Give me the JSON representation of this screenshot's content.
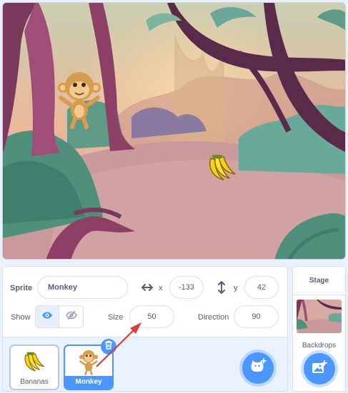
{
  "sprite_info": {
    "sprite_label": "Sprite",
    "sprite_name": "Monkey",
    "x_label": "x",
    "x_value": "-133",
    "y_label": "y",
    "y_value": "42",
    "show_label": "Show",
    "size_label": "Size",
    "size_value": "50",
    "direction_label": "Direction",
    "direction_value": "90"
  },
  "sprites": [
    {
      "name": "Bananas",
      "selected": false
    },
    {
      "name": "Monkey",
      "selected": true
    }
  ],
  "stage_panel": {
    "title": "Stage",
    "backdrops_label": "Backdrops"
  },
  "colors": {
    "accent": "#4c97ff",
    "annotation_arrow": "#e53935",
    "text": "#575e75"
  },
  "icons": {
    "show": "eye-icon",
    "hide": "eye-slash-icon",
    "x_axis": "horizontal-arrows-icon",
    "y_axis": "vertical-arrows-icon",
    "delete": "trash-icon",
    "add_sprite": "cat-add-icon",
    "add_backdrop": "image-add-icon"
  }
}
